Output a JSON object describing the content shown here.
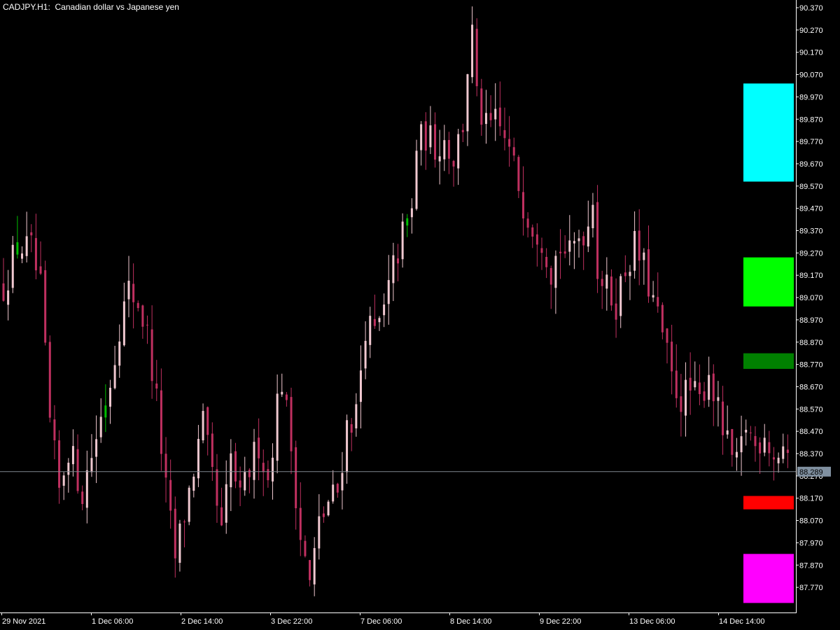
{
  "header": {
    "symbol": "CADJPY.",
    "timeframe": "H1:",
    "description": "Canadian dollar vs Japanese yen"
  },
  "current_price": "88.289",
  "colors": {
    "background": "#000000",
    "axis": "#ffffff",
    "candle_bear": "#c03060",
    "candle_bull": "#f0c8d0",
    "candle_green": "#00c000",
    "price_line": "#808890",
    "price_box": "#8090a0",
    "zone_cyan": "#00ffff",
    "zone_lime": "#00ff00",
    "zone_green": "#008000",
    "zone_red": "#ff0000",
    "zone_magenta": "#ff00ff"
  },
  "chart_data": {
    "type": "candlestick",
    "ylim": [
      87.7,
      90.4
    ],
    "y_ticks": [
      "90.370",
      "90.270",
      "90.170",
      "90.070",
      "89.970",
      "89.870",
      "89.770",
      "89.670",
      "89.570",
      "89.470",
      "89.370",
      "89.270",
      "89.170",
      "89.070",
      "88.970",
      "88.870",
      "88.770",
      "88.670",
      "88.570",
      "88.470",
      "88.370",
      "88.270",
      "88.170",
      "88.070",
      "87.970",
      "87.870",
      "87.770"
    ],
    "x_ticks": [
      "29 Nov 2021",
      "1 Dec 06:00",
      "2 Dec 14:00",
      "3 Dec 22:00",
      "7 Dec 06:00",
      "8 Dec 14:00",
      "9 Dec 22:00",
      "13 Dec 06:00",
      "14 Dec 14:00"
    ],
    "close_path": [
      [
        0,
        89.12
      ],
      [
        3,
        89.3
      ],
      [
        6,
        89.28
      ],
      [
        8,
        89.1
      ],
      [
        10,
        88.5
      ],
      [
        12,
        88.2
      ],
      [
        14,
        88.4
      ],
      [
        17,
        88.2
      ],
      [
        20,
        88.45
      ],
      [
        23,
        88.7
      ],
      [
        25,
        88.95
      ],
      [
        27,
        89.1
      ],
      [
        29,
        89.05
      ],
      [
        31,
        88.9
      ],
      [
        33,
        88.6
      ],
      [
        35,
        88.2
      ],
      [
        37,
        87.9
      ],
      [
        39,
        88.1
      ],
      [
        41,
        88.3
      ],
      [
        43,
        88.5
      ],
      [
        45,
        88.25
      ],
      [
        47,
        88.0
      ],
      [
        49,
        88.35
      ],
      [
        51,
        88.15
      ],
      [
        53,
        88.3
      ],
      [
        55,
        88.42
      ],
      [
        57,
        88.25
      ],
      [
        59,
        88.6
      ],
      [
        60,
        88.7
      ],
      [
        62,
        88.4
      ],
      [
        64,
        88.0
      ],
      [
        66,
        87.78
      ],
      [
        68,
        88.05
      ],
      [
        70,
        88.15
      ],
      [
        72,
        88.2
      ],
      [
        74,
        88.5
      ],
      [
        76,
        88.55
      ],
      [
        78,
        88.95
      ],
      [
        80,
        88.9
      ],
      [
        82,
        89.0
      ],
      [
        84,
        89.2
      ],
      [
        86,
        89.35
      ],
      [
        88,
        89.45
      ],
      [
        89,
        89.75
      ],
      [
        91,
        89.8
      ],
      [
        93,
        89.75
      ],
      [
        95,
        89.78
      ],
      [
        97,
        89.7
      ],
      [
        99,
        89.85
      ],
      [
        100,
        90.1
      ],
      [
        101,
        90.25
      ],
      [
        102,
        89.95
      ],
      [
        104,
        89.82
      ],
      [
        106,
        89.85
      ],
      [
        108,
        89.78
      ],
      [
        110,
        89.65
      ],
      [
        112,
        89.5
      ],
      [
        114,
        89.4
      ],
      [
        116,
        89.35
      ],
      [
        118,
        89.2
      ],
      [
        120,
        89.3
      ],
      [
        122,
        89.25
      ],
      [
        124,
        89.35
      ],
      [
        126,
        89.4
      ],
      [
        127,
        89.55
      ],
      [
        128,
        89.2
      ],
      [
        130,
        89.1
      ],
      [
        132,
        89.05
      ],
      [
        134,
        89.2
      ],
      [
        136,
        89.3
      ],
      [
        138,
        89.2
      ],
      [
        140,
        89.05
      ],
      [
        142,
        88.9
      ],
      [
        144,
        88.7
      ],
      [
        146,
        88.62
      ],
      [
        148,
        88.65
      ],
      [
        150,
        88.6
      ],
      [
        152,
        88.75
      ],
      [
        154,
        88.55
      ],
      [
        156,
        88.4
      ],
      [
        158,
        88.3
      ],
      [
        160,
        88.5
      ],
      [
        162,
        88.4
      ],
      [
        164,
        88.48
      ],
      [
        166,
        88.35
      ],
      [
        168,
        88.4
      ],
      [
        169,
        88.3
      ]
    ]
  },
  "zones": [
    {
      "name": "cyan",
      "from": 89.59,
      "to": 90.03
    },
    {
      "name": "lime",
      "from": 89.03,
      "to": 89.25
    },
    {
      "name": "green",
      "from": 88.75,
      "to": 88.82
    },
    {
      "name": "red",
      "from": 88.12,
      "to": 88.18
    },
    {
      "name": "magenta",
      "from": 87.7,
      "to": 87.92
    }
  ]
}
